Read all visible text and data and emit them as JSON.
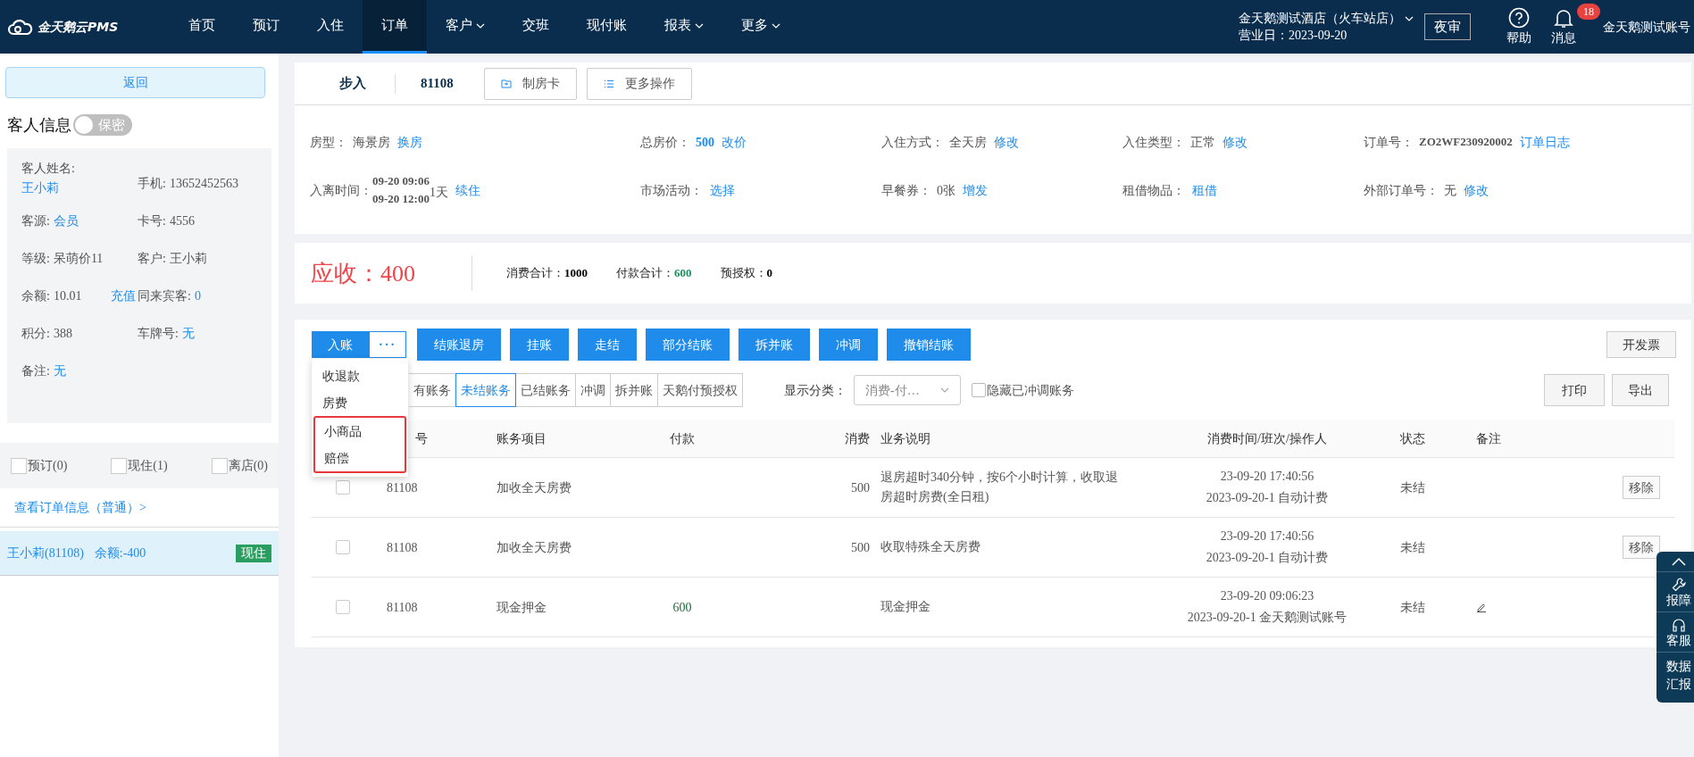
{
  "nav": {
    "logo": "金天鹅云PMS",
    "items": [
      {
        "label": "首页",
        "selected": false,
        "dropdown": false
      },
      {
        "label": "预订",
        "selected": false,
        "dropdown": false
      },
      {
        "label": "入住",
        "selected": false,
        "dropdown": false
      },
      {
        "label": "订单",
        "selected": true,
        "dropdown": false
      },
      {
        "label": "客户",
        "selected": false,
        "dropdown": true
      },
      {
        "label": "交班",
        "selected": false,
        "dropdown": false
      },
      {
        "label": "现付账",
        "selected": false,
        "dropdown": false
      },
      {
        "label": "报表",
        "selected": false,
        "dropdown": true
      },
      {
        "label": "更多",
        "selected": false,
        "dropdown": true
      }
    ],
    "hotel": "金天鹅测试酒店（火车站店）",
    "business_date": "营业日：2023-09-20",
    "night_audit": "夜审",
    "help": "帮助",
    "messages": "消息",
    "message_count": "18",
    "account": "金天鹅测试账号"
  },
  "sidebar": {
    "back": "返回",
    "guest_title": "客人信息",
    "privacy_toggle": {
      "label": "保密",
      "on": false
    },
    "guest_fields": [
      {
        "label": "客人姓名:",
        "value": "王小莉",
        "link": true,
        "stacked": true
      },
      {
        "label": "手机:",
        "value": "13652452563",
        "link": false
      },
      {
        "label": "客源:",
        "value": "会员",
        "link": true
      },
      {
        "label": "卡号:",
        "value": "4556",
        "link": false
      },
      {
        "label": "等级:",
        "value": "呆萌价11",
        "link": false
      },
      {
        "label": "客户:",
        "value": "王小莉",
        "link": false
      },
      {
        "label": "余额:",
        "value": "10.01",
        "link": false,
        "action": "充值"
      },
      {
        "label": "同来宾客:",
        "value": "0",
        "link": true
      },
      {
        "label": "积分:",
        "value": "388",
        "link": false
      },
      {
        "label": "车牌号:",
        "value": "无",
        "link": true
      },
      {
        "label": "备注:",
        "value": "无",
        "link": true
      }
    ],
    "filters": [
      {
        "label": "预订(0)",
        "checked": false
      },
      {
        "label": "现住(1)",
        "checked": false
      },
      {
        "label": "离店(0)",
        "checked": false
      }
    ],
    "order_link": "查看订单信息（普通）>",
    "guests": [
      {
        "name": "王小莉(81108)",
        "balance": "余额:-400",
        "status": "现住",
        "selected": true
      }
    ]
  },
  "order": {
    "type": "步入",
    "room": "81108",
    "buttons": [
      {
        "label": "制房卡"
      },
      {
        "label": "更多操作"
      }
    ],
    "fields": [
      {
        "kind": "plain",
        "label": "房型：",
        "value": "海景房",
        "action": "换房"
      },
      {
        "kind": "link",
        "label": "总房价：",
        "value": "500",
        "action": "改价"
      },
      {
        "kind": "plain",
        "label": "入住方式：",
        "value": "全天房",
        "action": "修改"
      },
      {
        "kind": "plain",
        "label": "入住类型：",
        "value": "正常",
        "action": "修改"
      },
      {
        "kind": "bold",
        "label": "订单号：",
        "value": "ZO2WF230920002",
        "action": "订单日志"
      },
      {
        "kind": "stay",
        "label": "入离时间：",
        "times": [
          "09-20 09:06",
          "09-20 12:00"
        ],
        "value": "1天",
        "action": "续住"
      },
      {
        "kind": "plain",
        "label": "市场活动：",
        "action": "选择"
      },
      {
        "kind": "plain",
        "label": "早餐券：",
        "value": "0张",
        "action": "增发"
      },
      {
        "kind": "plain",
        "label": "租借物品：",
        "action": "租借"
      },
      {
        "kind": "plain",
        "label": "外部订单号：",
        "value": "无",
        "action": "修改"
      }
    ]
  },
  "summary": {
    "due": "应收：400",
    "totals": [
      {
        "label": "消费合计：",
        "value": "1000",
        "color": "#000000"
      },
      {
        "label": "付款合计：",
        "value": "600",
        "color": "#1e9160"
      },
      {
        "label": "预授权：",
        "value": "0",
        "color": "#000000"
      }
    ]
  },
  "billing": {
    "post_button": "入账",
    "more_button": "···",
    "actions": [
      "结账退房",
      "挂账",
      "走结",
      "部分结账",
      "拆并账",
      "冲调",
      "撤销结账"
    ],
    "invoice_button": "开发票",
    "post_menu": [
      {
        "label": "收退款",
        "marked": false
      },
      {
        "label": "房费",
        "marked": false
      },
      {
        "label": "小商品",
        "marked": true
      },
      {
        "label": "赔偿",
        "marked": true
      }
    ],
    "tabs": [
      {
        "label": "有账务",
        "selected": false
      },
      {
        "label": "未结账务",
        "selected": true
      },
      {
        "label": "已结账务",
        "selected": false
      },
      {
        "label": "冲调",
        "selected": false
      },
      {
        "label": "拆并账",
        "selected": false
      },
      {
        "label": "天鹅付预授权",
        "selected": false
      }
    ],
    "category_label": "显示分类：",
    "category_value": "消费-付…",
    "hide_adjusted": {
      "label": "隐藏已冲调账务",
      "checked": false
    },
    "print_button": "打印",
    "export_button": "导出",
    "columns": [
      "号",
      "账务项目",
      "付款",
      "消费",
      "业务说明",
      "消费时间/班次/操作人",
      "状态",
      "备注"
    ],
    "rows": [
      {
        "checked": false,
        "room": "81108",
        "item": "加收全天房费",
        "payment": "",
        "charge": "500",
        "description": "退房超时340分钟，按6个小时计算，收取退房超时房费(全日租)",
        "time": [
          "23-09-20 17:40:56",
          "2023-09-20-1 自动计费"
        ],
        "status": "未结",
        "note_editable": false,
        "action": "移除"
      },
      {
        "checked": false,
        "room": "81108",
        "item": "加收全天房费",
        "payment": "",
        "charge": "500",
        "description": "收取特殊全天房费",
        "time": [
          "23-09-20 17:40:56",
          "2023-09-20-1 自动计费"
        ],
        "status": "未结",
        "note_editable": false,
        "action": "移除"
      },
      {
        "checked": false,
        "room": "81108",
        "item": "现金押金",
        "payment": "600",
        "charge": "",
        "description": "现金押金",
        "time": [
          "23-09-20 09:06:23",
          "2023-09-20-1 金天鹅测试账号"
        ],
        "status": "未结",
        "note_editable": true
      }
    ]
  },
  "float_panel": [
    {
      "kind": "up"
    },
    {
      "kind": "wrench",
      "label": "报障"
    },
    {
      "kind": "headset",
      "label": "客服"
    },
    {
      "kind": "text",
      "label": "数据汇报"
    }
  ]
}
